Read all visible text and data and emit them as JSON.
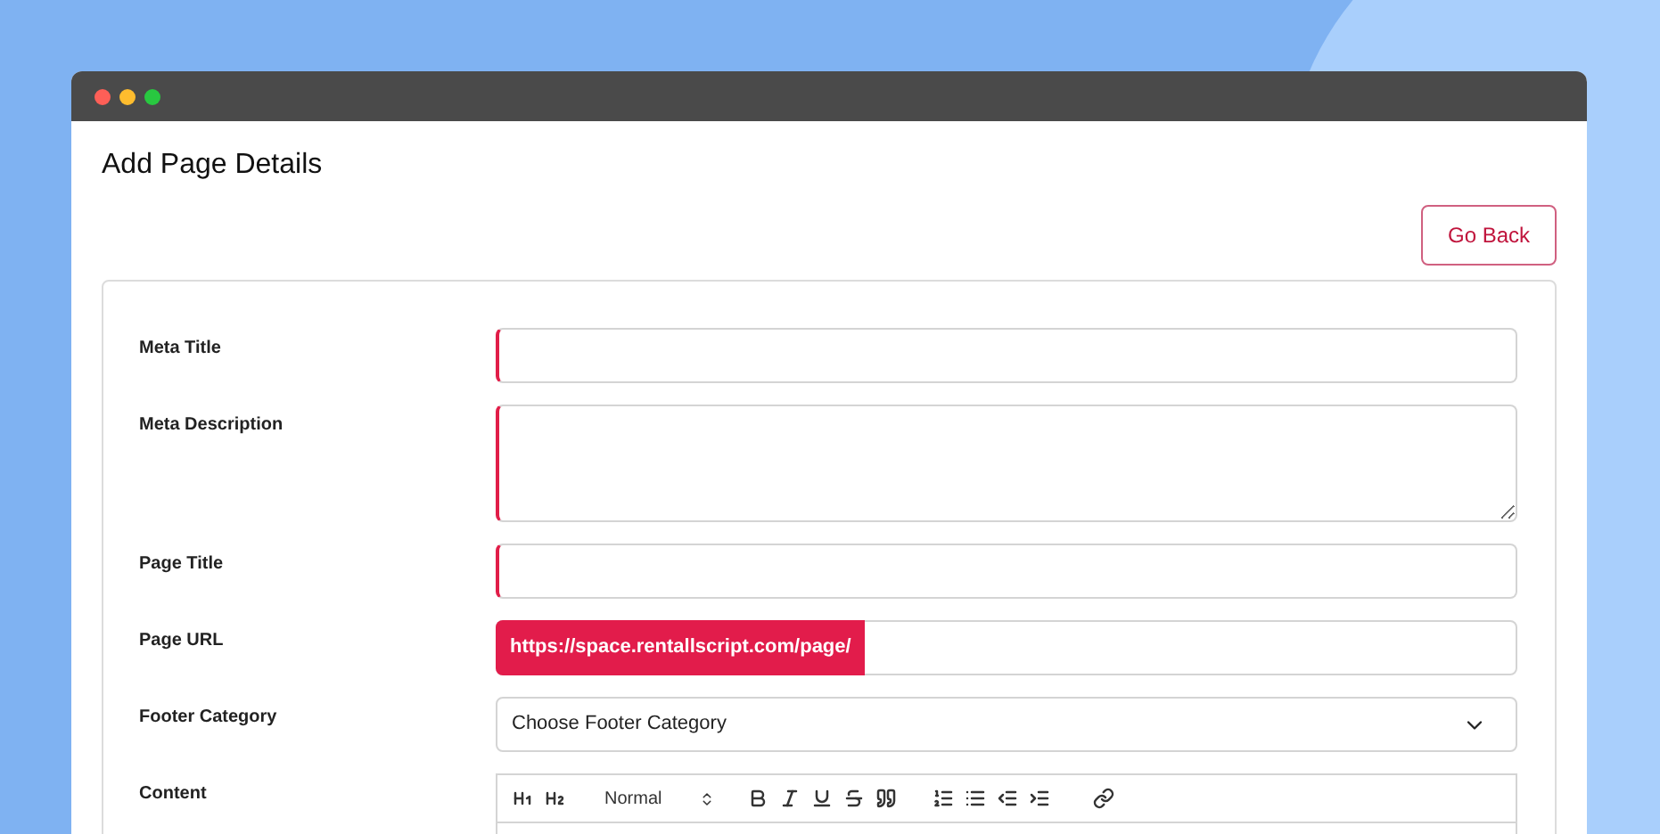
{
  "page": {
    "title": "Add Page Details",
    "back_button": "Go Back"
  },
  "fields": [
    {
      "kind": "input",
      "label": "Meta Title",
      "invalid": true
    },
    {
      "kind": "textarea",
      "label": "Meta Description",
      "invalid": true
    },
    {
      "kind": "input",
      "label": "Page Title",
      "invalid": true
    },
    {
      "kind": "prefixed",
      "label": "Page URL",
      "prefix": "https://space.rentallscript.com/page/",
      "invalid": false
    },
    {
      "kind": "select",
      "label": "Footer Category",
      "value": "Choose Footer Category",
      "invalid": false
    },
    {
      "kind": "editor",
      "label": "Content",
      "format": "Normal",
      "invalid": false
    }
  ]
}
